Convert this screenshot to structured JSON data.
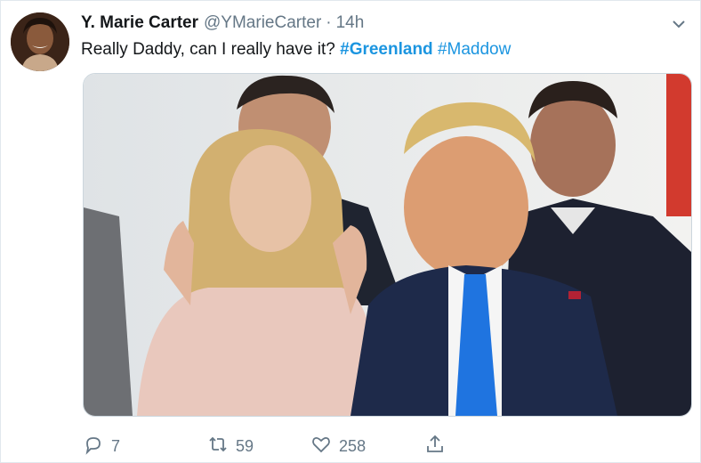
{
  "tweet": {
    "display_name": "Y. Marie Carter",
    "handle": "@YMarieCarter",
    "separator": "·",
    "time": "14h",
    "text_prefix": "Really Daddy, can I really have it? ",
    "hashtags": [
      "#Greenland",
      "#Maddow"
    ]
  },
  "actions": {
    "replies": "7",
    "retweets": "59",
    "likes": "258"
  },
  "icons": {
    "avatar": "avatar-photo",
    "menu": "chevron-down-icon",
    "reply": "reply-icon",
    "retweet": "retweet-icon",
    "like": "heart-icon",
    "share": "share-icon"
  },
  "colors": {
    "name": "#14171a",
    "meta": "#657786",
    "hashtag": "#1b95e0"
  }
}
